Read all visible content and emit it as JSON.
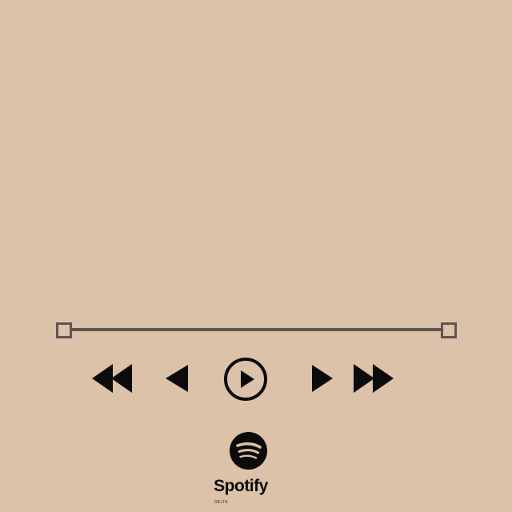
{
  "player": {
    "progress": {
      "fraction": 1.0
    },
    "controls": {
      "fast_rewind_icon": "fast-rewind-icon",
      "previous_icon": "previous-icon",
      "play_icon": "play-icon",
      "next_icon": "next-icon",
      "fast_forward_icon": "fast-forward-icon"
    }
  },
  "brand": {
    "logo_icon": "spotify-logo-icon",
    "name": "Spotify",
    "sub": "DELTA"
  },
  "colors": {
    "background": "#dcc2a8",
    "progress": "#5e5550",
    "icon": "#0b0b0b"
  }
}
